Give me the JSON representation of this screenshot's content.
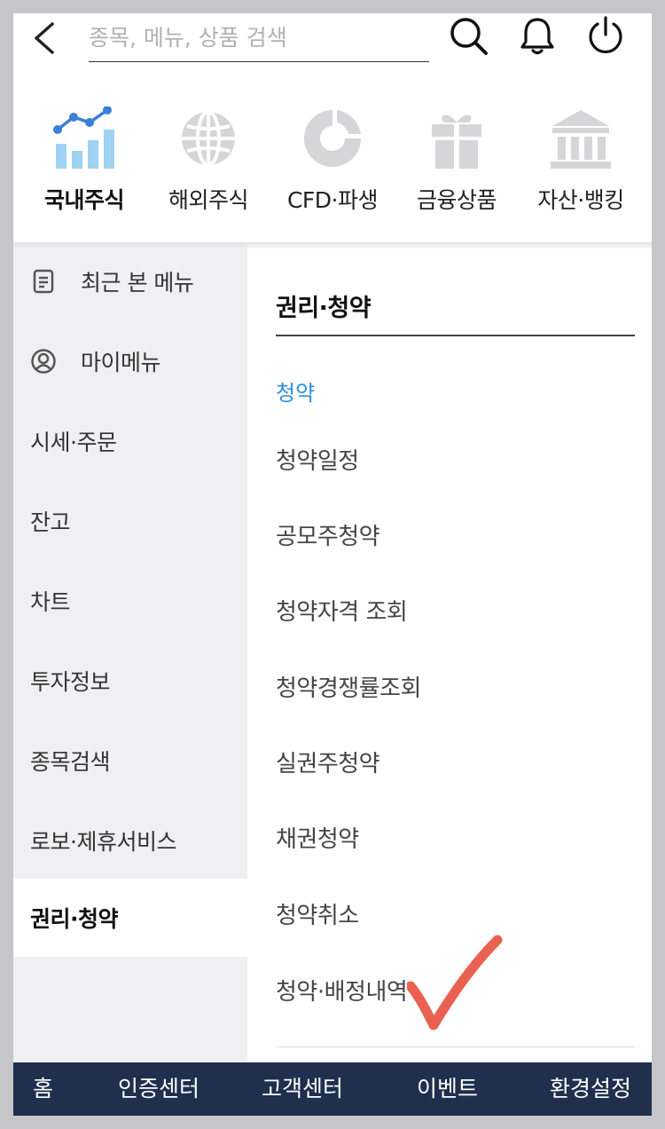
{
  "search": {
    "placeholder": "종목, 메뉴, 상품 검색"
  },
  "categories": [
    {
      "label": "국내주식",
      "icon": "stock-chart-icon",
      "active": true
    },
    {
      "label": "해외주식",
      "icon": "globe-icon",
      "active": false
    },
    {
      "label": "CFD·파생",
      "icon": "donut-chart-icon",
      "active": false
    },
    {
      "label": "금융상품",
      "icon": "gift-icon",
      "active": false
    },
    {
      "label": "자산·뱅킹",
      "icon": "bank-icon",
      "active": false
    }
  ],
  "leftnav": {
    "items": [
      {
        "label": "최근 본 메뉴",
        "icon": "recent-menu-icon"
      },
      {
        "label": "마이메뉴",
        "icon": "user-circle-icon"
      },
      {
        "label": "시세·주문"
      },
      {
        "label": "잔고"
      },
      {
        "label": "차트"
      },
      {
        "label": "투자정보"
      },
      {
        "label": "종목검색"
      },
      {
        "label": "로보·제휴서비스"
      },
      {
        "label": "권리·청약",
        "active": true
      }
    ]
  },
  "rightpanel": {
    "title": "권리·청약",
    "subsection": "청약",
    "links": [
      "청약일정",
      "공모주청약",
      "청약자격 조회",
      "청약경쟁률조회",
      "실권주청약",
      "채권청약",
      "청약취소",
      "청약·배정내역"
    ]
  },
  "bottombar": {
    "items": [
      "홈",
      "인증센터",
      "고객센터",
      "이벤트",
      "환경설정"
    ]
  },
  "colors": {
    "accent_blue": "#2f8fe0",
    "chart_blue": "#3a7fd6",
    "chart_bar": "#9fd2f3",
    "icon_grey": "#d6d6d8",
    "bottom_bar": "#1f2f4d",
    "left_nav_bg": "#f0f0f2",
    "annotation_red": "#e8503f"
  }
}
